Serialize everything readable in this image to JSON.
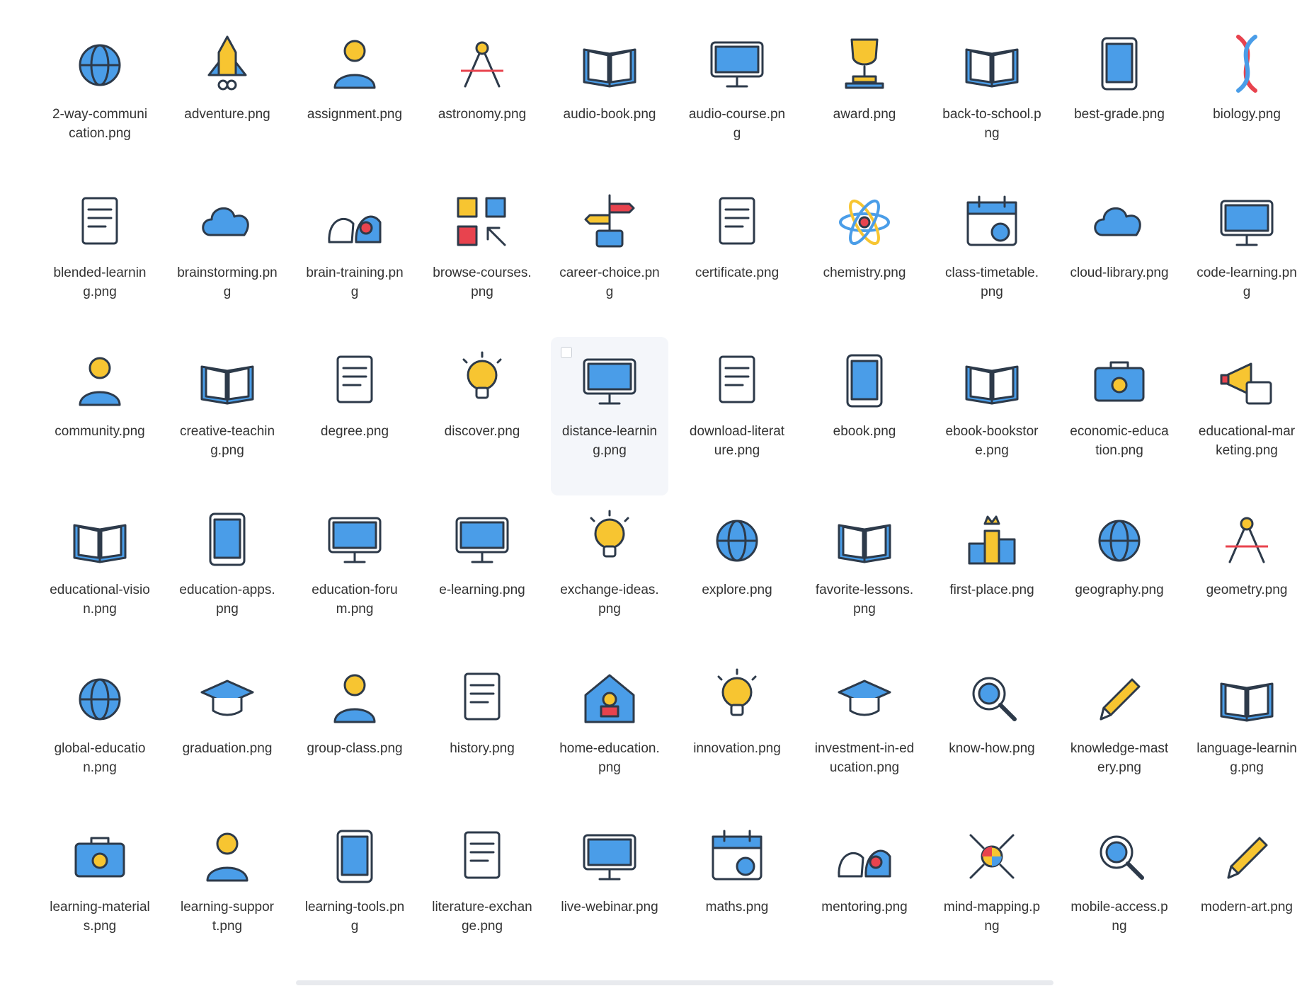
{
  "colors": {
    "outline": "#2d3a4a",
    "blue": "#4a9de8",
    "yellow": "#f7c531",
    "red": "#e8434e",
    "white": "#ffffff",
    "label_text": "#333333",
    "selected_bg": "#f4f6fa"
  },
  "files": [
    {
      "name": "2-way-communication.png",
      "icon": "2-way-communication-icon"
    },
    {
      "name": "adventure.png",
      "icon": "rocket-icon"
    },
    {
      "name": "assignment.png",
      "icon": "assignment-icon"
    },
    {
      "name": "astronomy.png",
      "icon": "telescope-icon"
    },
    {
      "name": "audio-book.png",
      "icon": "audio-book-icon"
    },
    {
      "name": "audio-course.png",
      "icon": "headset-icon"
    },
    {
      "name": "award.png",
      "icon": "trophy-icon"
    },
    {
      "name": "back-to-school.png",
      "icon": "books-apple-icon"
    },
    {
      "name": "best-grade.png",
      "icon": "best-grade-icon"
    },
    {
      "name": "biology.png",
      "icon": "dna-icon"
    },
    {
      "name": "blended-learning.png",
      "icon": "blended-learning-icon"
    },
    {
      "name": "brainstorming.png",
      "icon": "cloud-lightning-icon"
    },
    {
      "name": "brain-training.png",
      "icon": "brain-training-icon"
    },
    {
      "name": "browse-courses.png",
      "icon": "cubes-cursor-icon"
    },
    {
      "name": "career-choice.png",
      "icon": "signpost-icon"
    },
    {
      "name": "certificate.png",
      "icon": "certificate-icon"
    },
    {
      "name": "chemistry.png",
      "icon": "atom-icon"
    },
    {
      "name": "class-timetable.png",
      "icon": "calendar-check-icon"
    },
    {
      "name": "cloud-library.png",
      "icon": "cloud-library-icon"
    },
    {
      "name": "code-learning.png",
      "icon": "code-laptop-icon"
    },
    {
      "name": "community.png",
      "icon": "community-icon"
    },
    {
      "name": "creative-teaching.png",
      "icon": "book-bulb-icon"
    },
    {
      "name": "degree.png",
      "icon": "degree-icon"
    },
    {
      "name": "discover.png",
      "icon": "test-tube-icon"
    },
    {
      "name": "distance-learning.png",
      "icon": "monitor-globe-icon"
    },
    {
      "name": "download-literature.png",
      "icon": "document-download-icon"
    },
    {
      "name": "ebook.png",
      "icon": "tablet-icon"
    },
    {
      "name": "ebook-bookstore.png",
      "icon": "browser-book-icon"
    },
    {
      "name": "economic-education.png",
      "icon": "briefcase-coin-icon"
    },
    {
      "name": "educational-marketing.png",
      "icon": "megaphone-icon"
    },
    {
      "name": "educational-vision.png",
      "icon": "book-vision-icon"
    },
    {
      "name": "education-apps.png",
      "icon": "phone-apps-icon"
    },
    {
      "name": "education-forum.png",
      "icon": "forum-bank-icon"
    },
    {
      "name": "e-learning.png",
      "icon": "e-learning-icon"
    },
    {
      "name": "exchange-ideas.png",
      "icon": "bulb-exchange-icon"
    },
    {
      "name": "explore.png",
      "icon": "globe-books-icon"
    },
    {
      "name": "favorite-lessons.png",
      "icon": "book-heart-icon"
    },
    {
      "name": "first-place.png",
      "icon": "podium-icon"
    },
    {
      "name": "geography.png",
      "icon": "globe-compass-icon"
    },
    {
      "name": "geometry.png",
      "icon": "compass-tool-icon"
    },
    {
      "name": "global-education.png",
      "icon": "globe-cap-icon"
    },
    {
      "name": "graduation.png",
      "icon": "box-cap-icon"
    },
    {
      "name": "group-class.png",
      "icon": "students-desk-icon"
    },
    {
      "name": "history.png",
      "icon": "scroll-column-icon"
    },
    {
      "name": "home-education.png",
      "icon": "house-reading-icon"
    },
    {
      "name": "innovation.png",
      "icon": "head-bulb-icon"
    },
    {
      "name": "investment-in-education.png",
      "icon": "cap-coin-icon"
    },
    {
      "name": "know-how.png",
      "icon": "book-magnifier-icon"
    },
    {
      "name": "knowledge-mastery.png",
      "icon": "crossed-pencils-icon"
    },
    {
      "name": "language-learning.png",
      "icon": "abc-book-icon"
    },
    {
      "name": "learning-materials.png",
      "icon": "box-download-icon"
    },
    {
      "name": "learning-support.png",
      "icon": "reader-question-icon"
    },
    {
      "name": "learning-tools.png",
      "icon": "calculator-ruler-icon"
    },
    {
      "name": "literature-exchange.png",
      "icon": "documents-exchange-icon"
    },
    {
      "name": "live-webinar.png",
      "icon": "laptop-webinar-icon"
    },
    {
      "name": "maths.png",
      "icon": "notebook-calculator-icon"
    },
    {
      "name": "mentoring.png",
      "icon": "heads-gear-icon"
    },
    {
      "name": "mind-mapping.png",
      "icon": "mind-map-icon"
    },
    {
      "name": "mobile-access.png",
      "icon": "tablet-search-icon"
    },
    {
      "name": "modern-art.png",
      "icon": "art-tablet-icon"
    }
  ],
  "selected_index": 24
}
